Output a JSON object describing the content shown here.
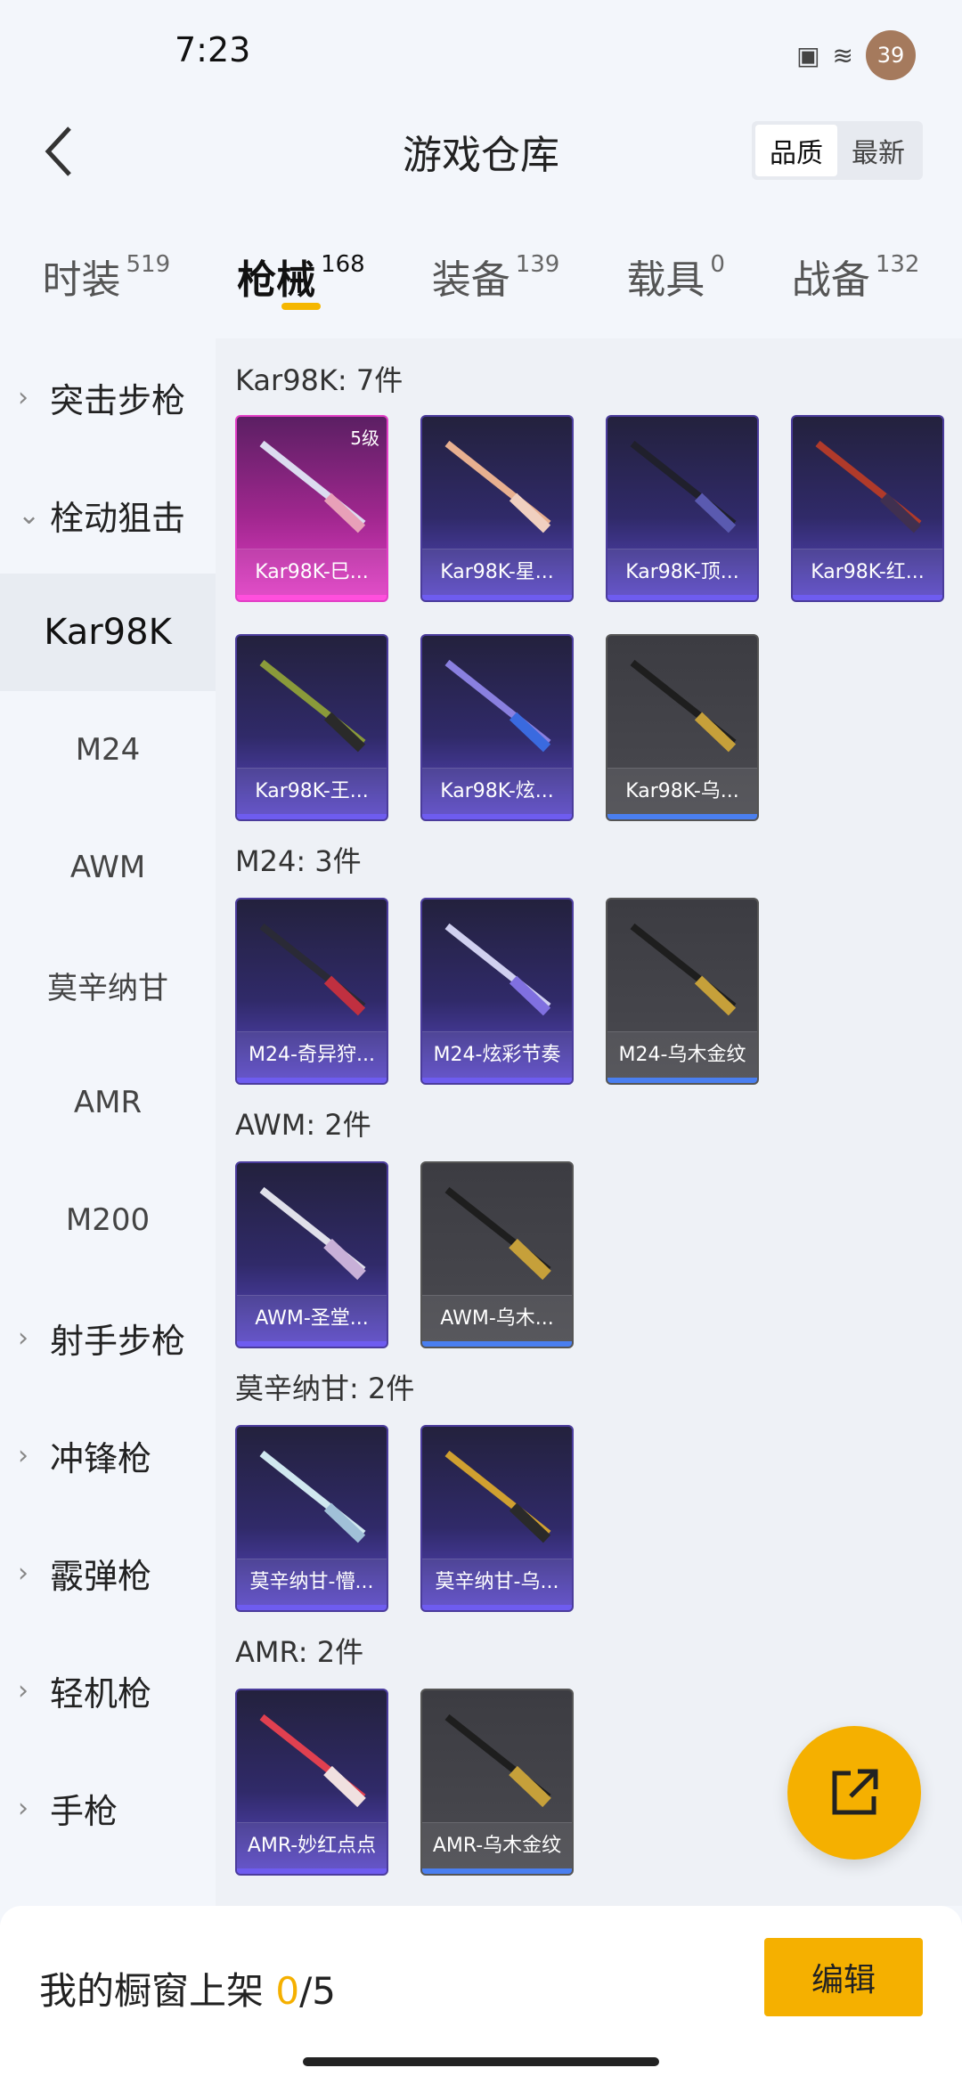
{
  "status_bar": {
    "time": "7:23",
    "battery": "39"
  },
  "header": {
    "title": "游戏仓库",
    "sort_options": [
      "品质",
      "最新"
    ]
  },
  "tabs": [
    {
      "label": "时装",
      "count": "519"
    },
    {
      "label": "枪械",
      "count": "168"
    },
    {
      "label": "装备",
      "count": "139"
    },
    {
      "label": "载具",
      "count": "0"
    },
    {
      "label": "战备",
      "count": "132"
    }
  ],
  "sidebar": {
    "items": [
      {
        "label": "突击步枪",
        "type": "category"
      },
      {
        "label": "栓动狙击",
        "type": "category"
      },
      {
        "label": "Kar98K",
        "type": "sub"
      },
      {
        "label": "M24",
        "type": "sub"
      },
      {
        "label": "AWM",
        "type": "sub"
      },
      {
        "label": "莫辛纳甘",
        "type": "sub"
      },
      {
        "label": "AMR",
        "type": "sub"
      },
      {
        "label": "M200",
        "type": "sub"
      },
      {
        "label": "射手步枪",
        "type": "category"
      },
      {
        "label": "冲锋枪",
        "type": "category"
      },
      {
        "label": "霰弹枪",
        "type": "category"
      },
      {
        "label": "轻机枪",
        "type": "category"
      },
      {
        "label": "手枪",
        "type": "category"
      }
    ]
  },
  "sections": [
    {
      "title": "Kar98K: 7件",
      "items": [
        {
          "label": "Kar98K-巳...",
          "level": "5级",
          "color": "pink"
        },
        {
          "label": "Kar98K-星...",
          "color": "purple"
        },
        {
          "label": "Kar98K-顶...",
          "color": "purple"
        },
        {
          "label": "Kar98K-红...",
          "color": "purple"
        },
        {
          "label": "Kar98K-王...",
          "color": "purple"
        },
        {
          "label": "Kar98K-炫...",
          "color": "purple"
        },
        {
          "label": "Kar98K-乌...",
          "color": "gray"
        }
      ]
    },
    {
      "title": "M24: 3件",
      "items": [
        {
          "label": "M24-奇异狩...",
          "color": "purple"
        },
        {
          "label": "M24-炫彩节奏",
          "color": "purple"
        },
        {
          "label": "M24-乌木金纹",
          "color": "gray"
        }
      ]
    },
    {
      "title": "AWM: 2件",
      "items": [
        {
          "label": "AWM-圣堂...",
          "color": "purple"
        },
        {
          "label": "AWM-乌木...",
          "color": "gray"
        }
      ]
    },
    {
      "title": "莫辛纳甘: 2件",
      "items": [
        {
          "label": "莫辛纳甘-懵...",
          "color": "purple"
        },
        {
          "label": "莫辛纳甘-乌...",
          "color": "purple"
        }
      ]
    },
    {
      "title": "AMR: 2件",
      "items": [
        {
          "label": "AMR-妙红点点",
          "color": "purple"
        },
        {
          "label": "AMR-乌木金纹",
          "color": "gray"
        }
      ]
    }
  ],
  "bottom": {
    "showcase_label": "我的橱窗上架",
    "showcase_count": "0",
    "showcase_total": "/5",
    "edit_label": "编辑"
  },
  "icons": {
    "back": "chevron-left-icon",
    "fab": "share-export-icon"
  },
  "colors": {
    "accent": "#f5b000"
  }
}
